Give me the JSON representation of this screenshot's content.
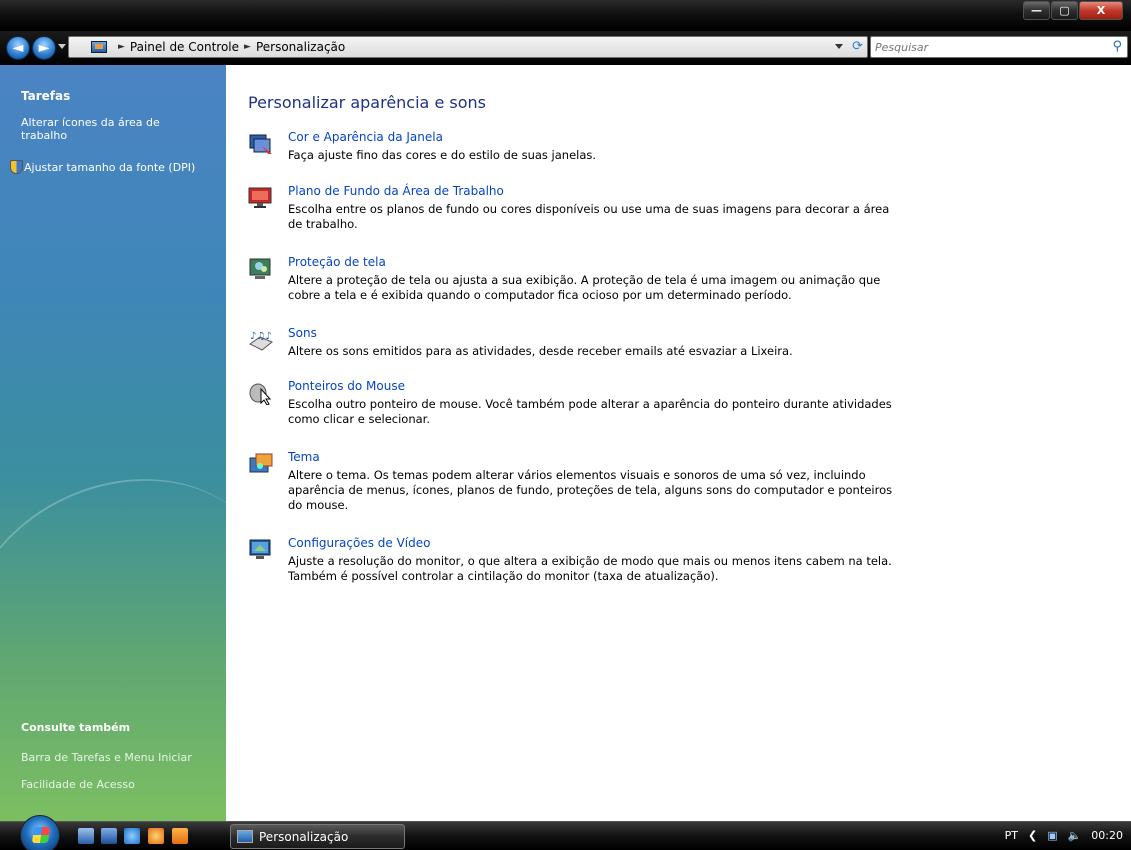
{
  "window": {
    "minimize_label": "—",
    "maximize_label": "▢",
    "close_label": "X"
  },
  "nav": {
    "back_glyph": "◄",
    "forward_glyph": "►",
    "breadcrumb": [
      "Painel de Controle",
      "Personalização"
    ],
    "search_placeholder": "Pesquisar"
  },
  "sidebar": {
    "tasks_heading": "Tarefas",
    "task_links": [
      {
        "label": "Alterar ícones da área de trabalho"
      },
      {
        "label": "Ajustar tamanho da fonte (DPI)",
        "icon": "shield-icon"
      }
    ],
    "see_also_heading": "Consulte também",
    "see_also_links": [
      {
        "label": "Barra de Tarefas e Menu Iniciar"
      },
      {
        "label": "Facilidade de Acesso"
      }
    ]
  },
  "main": {
    "title": "Personalizar aparência e sons",
    "items": [
      {
        "title": "Cor e Aparência da Janela",
        "description": "Faça ajuste fino das cores e do estilo de suas janelas.",
        "icon": "window-color-icon"
      },
      {
        "title": "Plano de Fundo da Área de Trabalho",
        "description": "Escolha entre os planos de fundo ou cores disponíveis ou use uma de suas imagens para decorar a área de trabalho.",
        "icon": "desktop-background-icon"
      },
      {
        "title": "Proteção de tela",
        "description": "Altere a proteção de tela ou ajusta a sua exibição. A proteção de tela é uma imagem ou animação que cobre a tela e é exibida quando o computador fica ocioso por um determinado período.",
        "icon": "screensaver-icon"
      },
      {
        "title": "Sons",
        "description": "Altere os sons emitidos para as atividades, desde receber emails até esvaziar a Lixeira.",
        "icon": "sounds-icon"
      },
      {
        "title": "Ponteiros do Mouse",
        "description": "Escolha outro ponteiro de mouse. Você também pode alterar a aparência do ponteiro durante atividades como clicar e selecionar.",
        "icon": "mouse-pointer-icon"
      },
      {
        "title": "Tema",
        "description": "Altere o tema. Os temas podem alterar vários elementos visuais e sonoros de uma só vez, incluindo aparência de menus, ícones, planos de fundo, proteções de tela, alguns sons do computador e ponteiros do mouse.",
        "icon": "theme-icon"
      },
      {
        "title": "Configurações de Vídeo",
        "description": "Ajuste a resolução do monitor, o que altera a exibição de modo que mais ou menos itens cabem na tela. Também é possível controlar a cintilação do monitor (taxa de atualização).",
        "icon": "display-settings-icon"
      }
    ]
  },
  "taskbar": {
    "active_window": "Personalização",
    "language": "PT",
    "clock": "00:20"
  },
  "colors": {
    "link": "#0645c2",
    "title": "#1e3287",
    "sidebar_top": "#4b84c4",
    "sidebar_bottom": "#7cbf62"
  }
}
